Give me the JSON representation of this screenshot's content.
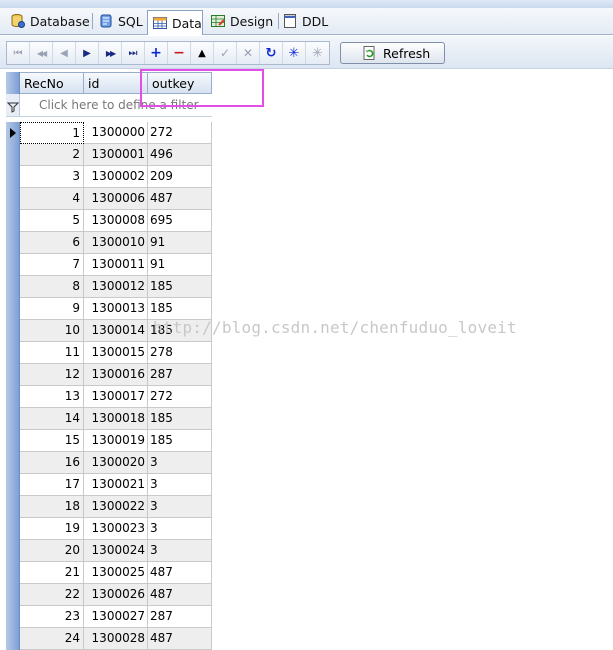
{
  "tabs": [
    {
      "label": "Database",
      "icon": "database-icon",
      "active": false
    },
    {
      "label": "SQL",
      "icon": "sql-scroll-icon",
      "active": false
    },
    {
      "label": "Data",
      "icon": "data-grid-icon",
      "active": true
    },
    {
      "label": "Design",
      "icon": "design-table-icon",
      "active": false
    },
    {
      "label": "DDL",
      "icon": "ddl-document-icon",
      "active": false
    }
  ],
  "toolbar": {
    "nav_buttons": [
      {
        "name": "first-record-button",
        "glyph": "⏮",
        "enabled": false
      },
      {
        "name": "prior-page-button",
        "glyph": "◀◀",
        "enabled": false
      },
      {
        "name": "prior-record-button",
        "glyph": "◀",
        "enabled": false
      },
      {
        "name": "next-record-button",
        "glyph": "▶",
        "enabled": true
      },
      {
        "name": "next-page-button",
        "glyph": "▶▶",
        "enabled": true
      },
      {
        "name": "last-record-button",
        "glyph": "⏭",
        "enabled": true
      },
      {
        "name": "insert-record-button",
        "glyph": "+",
        "enabled": true
      },
      {
        "name": "delete-record-button",
        "glyph": "−",
        "enabled": true
      },
      {
        "name": "edit-record-button",
        "glyph": "▲",
        "enabled": true
      },
      {
        "name": "post-edit-button",
        "glyph": "✓",
        "enabled": false
      },
      {
        "name": "cancel-edit-button",
        "glyph": "✕",
        "enabled": false
      },
      {
        "name": "refresh-record-button",
        "glyph": "↻",
        "enabled": true
      },
      {
        "name": "set-bookmark-button",
        "glyph": "✳",
        "enabled": true
      },
      {
        "name": "clear-bookmark-button",
        "glyph": "✳",
        "enabled": false
      }
    ],
    "refresh_label": "Refresh"
  },
  "grid": {
    "columns": [
      "RecNo",
      "id",
      "outkey"
    ],
    "filter_placeholder": "Click here to define a filter",
    "rows": [
      {
        "recno": "1",
        "id": "1300000",
        "outkey": "272"
      },
      {
        "recno": "2",
        "id": "1300001",
        "outkey": "496"
      },
      {
        "recno": "3",
        "id": "1300002",
        "outkey": "209"
      },
      {
        "recno": "4",
        "id": "1300006",
        "outkey": "487"
      },
      {
        "recno": "5",
        "id": "1300008",
        "outkey": "695"
      },
      {
        "recno": "6",
        "id": "1300010",
        "outkey": "91"
      },
      {
        "recno": "7",
        "id": "1300011",
        "outkey": "91"
      },
      {
        "recno": "8",
        "id": "1300012",
        "outkey": "185"
      },
      {
        "recno": "9",
        "id": "1300013",
        "outkey": "185"
      },
      {
        "recno": "10",
        "id": "1300014",
        "outkey": "185"
      },
      {
        "recno": "11",
        "id": "1300015",
        "outkey": "278"
      },
      {
        "recno": "12",
        "id": "1300016",
        "outkey": "287"
      },
      {
        "recno": "13",
        "id": "1300017",
        "outkey": "272"
      },
      {
        "recno": "14",
        "id": "1300018",
        "outkey": "185"
      },
      {
        "recno": "15",
        "id": "1300019",
        "outkey": "185"
      },
      {
        "recno": "16",
        "id": "1300020",
        "outkey": "3"
      },
      {
        "recno": "17",
        "id": "1300021",
        "outkey": "3"
      },
      {
        "recno": "18",
        "id": "1300022",
        "outkey": "3"
      },
      {
        "recno": "19",
        "id": "1300023",
        "outkey": "3"
      },
      {
        "recno": "20",
        "id": "1300024",
        "outkey": "3"
      },
      {
        "recno": "21",
        "id": "1300025",
        "outkey": "487"
      },
      {
        "recno": "22",
        "id": "1300026",
        "outkey": "487"
      },
      {
        "recno": "23",
        "id": "1300027",
        "outkey": "287"
      },
      {
        "recno": "24",
        "id": "1300028",
        "outkey": "487"
      }
    ]
  },
  "watermark": "http://blog.csdn.net/chenfuduo_loveit",
  "colors": {
    "highlight_box": "#e24fe6",
    "indicator": "#7f9fd4"
  }
}
